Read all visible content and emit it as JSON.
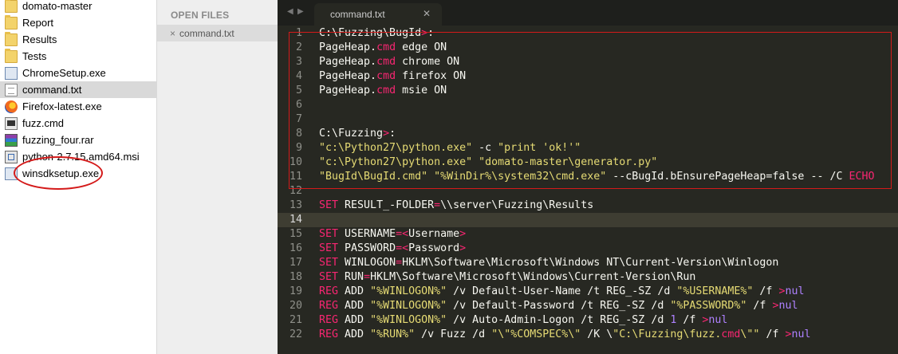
{
  "explorer": {
    "files": [
      {
        "name": "domato-master",
        "icon": "folder-icon"
      },
      {
        "name": "Report",
        "icon": "folder-icon"
      },
      {
        "name": "Results",
        "icon": "folder-icon"
      },
      {
        "name": "Tests",
        "icon": "folder-icon"
      },
      {
        "name": "ChromeSetup.exe",
        "icon": "installer-icon"
      },
      {
        "name": "command.txt",
        "icon": "text-file-icon"
      },
      {
        "name": "Firefox-latest.exe",
        "icon": "firefox-icon"
      },
      {
        "name": "fuzz.cmd",
        "icon": "batch-file-icon"
      },
      {
        "name": "fuzzing_four.rar",
        "icon": "archive-icon"
      },
      {
        "name": "python-2.7.15.amd64.msi",
        "icon": "msi-installer-icon"
      },
      {
        "name": "winsdksetup.exe",
        "icon": "installer-icon"
      }
    ]
  },
  "sidebar": {
    "title": "OPEN FILES",
    "close_glyph": "×",
    "open_file": "command.txt"
  },
  "editor": {
    "nav_left": "◀",
    "nav_right": "▶",
    "tab_label": "command.txt",
    "tab_close": "✕",
    "current_line": 14,
    "lines": [
      [
        {
          "t": "C:\\Fuzzing\\BugId"
        },
        {
          "t": ">",
          "c": "p"
        },
        {
          "t": ":"
        }
      ],
      [
        {
          "t": "PageHeap."
        },
        {
          "t": "cmd",
          "c": "p"
        },
        {
          "t": " edge ON"
        }
      ],
      [
        {
          "t": "PageHeap."
        },
        {
          "t": "cmd",
          "c": "p"
        },
        {
          "t": " chrome ON"
        }
      ],
      [
        {
          "t": "PageHeap."
        },
        {
          "t": "cmd",
          "c": "p"
        },
        {
          "t": " firefox ON"
        }
      ],
      [
        {
          "t": "PageHeap."
        },
        {
          "t": "cmd",
          "c": "p"
        },
        {
          "t": " msie ON"
        }
      ],
      [],
      [],
      [
        {
          "t": "C:\\Fuzzing"
        },
        {
          "t": ">",
          "c": "p"
        },
        {
          "t": ":"
        }
      ],
      [
        {
          "t": "\"c:\\Python27\\python.exe\"",
          "c": "s"
        },
        {
          "t": " -c "
        },
        {
          "t": "\"print 'ok!'\"",
          "c": "s"
        }
      ],
      [
        {
          "t": "\"c:\\Python27\\python.exe\"",
          "c": "s"
        },
        {
          "t": " "
        },
        {
          "t": "\"domato-master\\generator.py\"",
          "c": "s"
        }
      ],
      [
        {
          "t": "\"BugId\\BugId.cmd\"",
          "c": "s"
        },
        {
          "t": " "
        },
        {
          "t": "\"%WinDir%\\system32\\cmd.exe\"",
          "c": "s"
        },
        {
          "t": " --cBugId.bEnsurePageHeap=false -- /C "
        },
        {
          "t": "ECHO",
          "c": "p"
        }
      ],
      [],
      [
        {
          "t": "SET",
          "c": "p"
        },
        {
          "t": " RESULT_-FOLDER"
        },
        {
          "t": "=",
          "c": "p"
        },
        {
          "t": "\\\\server\\Fuzzing\\Results"
        }
      ],
      [],
      [
        {
          "t": "SET",
          "c": "p"
        },
        {
          "t": " USERNAME"
        },
        {
          "t": "=<",
          "c": "p"
        },
        {
          "t": "Username"
        },
        {
          "t": ">",
          "c": "p"
        }
      ],
      [
        {
          "t": "SET",
          "c": "p"
        },
        {
          "t": " PASSWORD"
        },
        {
          "t": "=<",
          "c": "p"
        },
        {
          "t": "Password"
        },
        {
          "t": ">",
          "c": "p"
        }
      ],
      [
        {
          "t": "SET",
          "c": "p"
        },
        {
          "t": " WINLOGON"
        },
        {
          "t": "=",
          "c": "p"
        },
        {
          "t": "HKLM\\Software\\Microsoft\\Windows NT\\Current-Version\\Winlogon"
        }
      ],
      [
        {
          "t": "SET",
          "c": "p"
        },
        {
          "t": " RUN"
        },
        {
          "t": "=",
          "c": "p"
        },
        {
          "t": "HKLM\\Software\\Microsoft\\Windows\\Current-Version\\Run"
        }
      ],
      [
        {
          "t": "REG",
          "c": "p"
        },
        {
          "t": " ADD "
        },
        {
          "t": "\"%WINLOGON%\"",
          "c": "s"
        },
        {
          "t": " /v Default-User-Name /t REG_-SZ /d "
        },
        {
          "t": "\"%USERNAME%\"",
          "c": "s"
        },
        {
          "t": " /f "
        },
        {
          "t": ">",
          "c": "p"
        },
        {
          "t": "nul",
          "c": "n"
        }
      ],
      [
        {
          "t": "REG",
          "c": "p"
        },
        {
          "t": " ADD "
        },
        {
          "t": "\"%WINLOGON%\"",
          "c": "s"
        },
        {
          "t": " /v Default-Password /t REG_-SZ /d "
        },
        {
          "t": "\"%PASSWORD%\"",
          "c": "s"
        },
        {
          "t": " /f "
        },
        {
          "t": ">",
          "c": "p"
        },
        {
          "t": "nul",
          "c": "n"
        }
      ],
      [
        {
          "t": "REG",
          "c": "p"
        },
        {
          "t": " ADD "
        },
        {
          "t": "\"%WINLOGON%\"",
          "c": "s"
        },
        {
          "t": " /v Auto-Admin-Logon /t REG_-SZ /d "
        },
        {
          "t": "1",
          "c": "n"
        },
        {
          "t": " /f "
        },
        {
          "t": ">",
          "c": "p"
        },
        {
          "t": "nul",
          "c": "n"
        }
      ],
      [
        {
          "t": "REG",
          "c": "p"
        },
        {
          "t": " ADD "
        },
        {
          "t": "\"%RUN%\"",
          "c": "s"
        },
        {
          "t": " /v Fuzz /d "
        },
        {
          "t": "\"\\\"%COMSPEC%\\\"",
          "c": "s"
        },
        {
          "t": " /K \\"
        },
        {
          "t": "\"C:\\Fuzzing\\fuzz.",
          "c": "s"
        },
        {
          "t": "cmd",
          "c": "p"
        },
        {
          "t": "\\\"\"",
          "c": "s"
        },
        {
          "t": " /f "
        },
        {
          "t": ">",
          "c": "p"
        },
        {
          "t": "nul",
          "c": "n"
        }
      ]
    ]
  }
}
